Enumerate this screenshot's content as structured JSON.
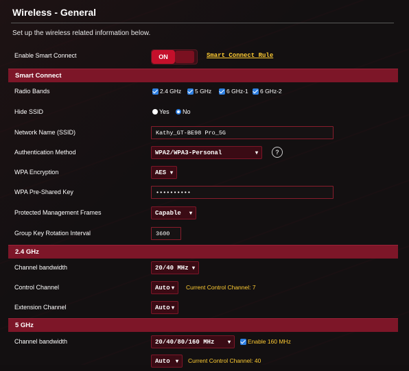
{
  "header": {
    "title": "Wireless - General",
    "subtitle": "Set up the wireless related information below."
  },
  "smart_connect_toggle": {
    "label": "Enable Smart Connect",
    "state": "ON",
    "link": "Smart Connect Rule"
  },
  "sections": {
    "smart_connect": "Smart Connect",
    "band_24": "2.4 GHz",
    "band_5": "5 GHz"
  },
  "radio_bands": {
    "label": "Radio Bands",
    "options": [
      "2.4 GHz",
      "5 GHz",
      "6 GHz-1",
      "6 GHz-2"
    ]
  },
  "hide_ssid": {
    "label": "Hide SSID",
    "yes": "Yes",
    "no": "No",
    "selected": "No"
  },
  "ssid": {
    "label": "Network Name (SSID)",
    "value": "Kathy_GT-BE98 Pro_5G"
  },
  "auth": {
    "label": "Authentication Method",
    "value": "WPA2/WPA3-Personal",
    "help": "?"
  },
  "wpa_encryption": {
    "label": "WPA Encryption",
    "value": "AES"
  },
  "psk": {
    "label": "WPA Pre-Shared Key",
    "value": "••••••••••"
  },
  "pmf": {
    "label": "Protected Management Frames",
    "value": "Capable"
  },
  "gkri": {
    "label": "Group Key Rotation Interval",
    "value": "3600"
  },
  "band24": {
    "bandwidth_label": "Channel bandwidth",
    "bandwidth_value": "20/40 MHz",
    "control_label": "Control Channel",
    "control_value": "Auto",
    "control_note": "Current Control Channel: 7",
    "extension_label": "Extension Channel",
    "extension_value": "Auto"
  },
  "band5": {
    "bandwidth_label": "Channel bandwidth",
    "bandwidth_value": "20/40/80/160 MHz",
    "enable160": "Enable 160 MHz",
    "control_value": "Auto",
    "control_note": "Current Control Channel: 40"
  },
  "colors": {
    "accent": "#7d1628",
    "toggle_on": "#c4102b",
    "note": "#ffcc33",
    "checkbox": "#2f7fe0"
  }
}
